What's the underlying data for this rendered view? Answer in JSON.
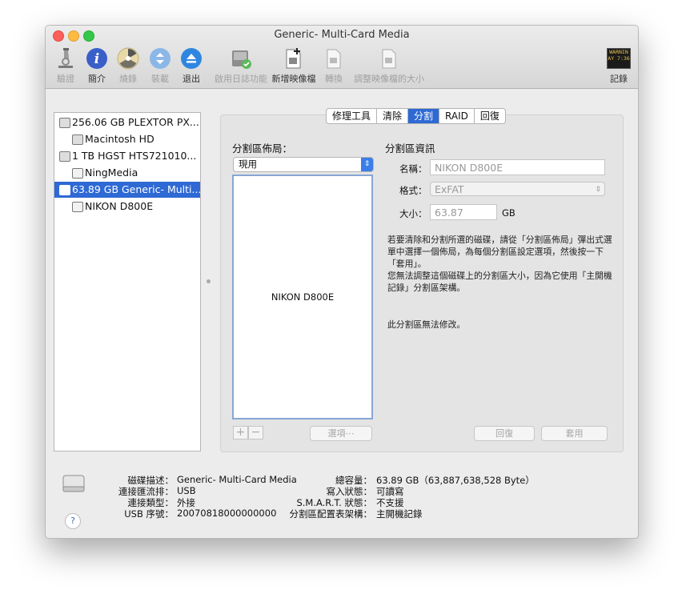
{
  "window": {
    "title": "Generic- Multi-Card Media"
  },
  "toolbar": {
    "verify": "驗證",
    "info": "簡介",
    "burn": "燒錄",
    "mount": "裝載",
    "eject": "退出",
    "journal": "啟用日誌功能",
    "new_image": "新增映像檔",
    "convert": "轉換",
    "resize_image": "調整映像檔的大小",
    "log": "記錄",
    "log_icon_text": "WARNIN\nAY 7:36"
  },
  "sidebar": {
    "items": [
      {
        "label": "256.06 GB PLEXTOR PX..."
      },
      {
        "label": "Macintosh HD"
      },
      {
        "label": "1 TB HGST HTS721010..."
      },
      {
        "label": "NingMedia"
      },
      {
        "label": "63.89 GB Generic- Multi..."
      },
      {
        "label": "NIKON D800E"
      }
    ]
  },
  "tabs": [
    "修理工具",
    "清除",
    "分割",
    "RAID",
    "回復"
  ],
  "active_tab": "分割",
  "partition": {
    "layout_title": "分割區佈局：",
    "layout_popup_value": "現用",
    "layout_partition_name": "NIKON D800E",
    "info_title": "分割區資訊",
    "name_label": "名稱：",
    "name_value": "NIKON D800E",
    "format_label": "格式：",
    "format_value": "ExFAT",
    "size_label": "大小：",
    "size_value": "63.87",
    "size_unit": "GB",
    "help_text_1": "若要清除和分割所選的磁碟，請從「分割區佈局」彈出式選單中選擇一個佈局，為每個分割區設定選項，然後按一下「套用」。",
    "help_text_2": "您無法調整這個磁碟上的分割區大小，因為它使用「主開機記錄」分割區架構。",
    "help_text_3": "此分割區無法修改。",
    "plus": "+",
    "minus": "−",
    "options_button": "選項⋯",
    "revert_button": "回復",
    "apply_button": "套用"
  },
  "footer": {
    "disk_desc_label": "磁碟描述：",
    "disk_desc_value": "Generic- Multi-Card Media",
    "connection_bus_label": "連接匯流排：",
    "connection_bus_value": "USB",
    "connection_type_label": "連接類型：",
    "connection_type_value": "外接",
    "usb_serial_label": "USB 序號：",
    "usb_serial_value": "20070818000000000",
    "total_capacity_label": "總容量：",
    "total_capacity_value": "63.89 GB（63,887,638,528 Byte）",
    "write_status_label": "寫入狀態：",
    "write_status_value": "可讀寫",
    "smart_label": "S.M.A.R.T. 狀態：",
    "smart_value": "不支援",
    "scheme_label": "分割區配置表架構：",
    "scheme_value": "主開機記錄",
    "help_glyph": "?"
  }
}
